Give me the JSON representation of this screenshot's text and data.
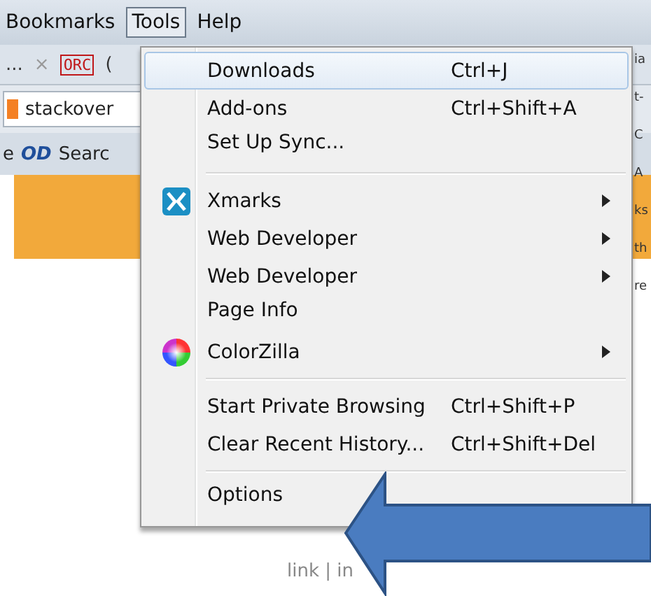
{
  "menubar": [
    {
      "label": "Bookmarks",
      "selected": false
    },
    {
      "label": "Tools",
      "selected": true
    },
    {
      "label": "Help",
      "selected": false
    }
  ],
  "tab_strip": {
    "tab_text": "...",
    "close": "×",
    "favicon": "ORC",
    "tab_text_2": "("
  },
  "address_bar": {
    "value": "stackover"
  },
  "bookmarks_bar": {
    "lead": "e",
    "logo": "OD",
    "label": "Searc"
  },
  "page_fragments": [
    "ia",
    "t-",
    "C",
    "A",
    "ks",
    "th",
    "re"
  ],
  "footer_fragment": "link | in",
  "tools_menu": [
    {
      "kind": "item",
      "label": "Downloads",
      "shortcut": "Ctrl+J",
      "highlighted": true
    },
    {
      "kind": "item",
      "label": "Add-ons",
      "shortcut": "Ctrl+Shift+A",
      "highlighted": false
    },
    {
      "kind": "item",
      "label": "Set Up Sync...",
      "highlighted": false
    },
    {
      "kind": "separator"
    },
    {
      "kind": "submenu",
      "label": "Xmarks",
      "highlighted": false
    },
    {
      "kind": "submenu",
      "label": "Web Developer",
      "highlighted": false
    },
    {
      "kind": "submenu",
      "label": "Web Developer",
      "highlighted": false
    },
    {
      "kind": "item",
      "label": "Page Info",
      "highlighted": false
    },
    {
      "kind": "submenu",
      "label": "ColorZilla",
      "highlighted": false
    },
    {
      "kind": "separator"
    },
    {
      "kind": "item",
      "label": "Start Private Browsing",
      "shortcut": "Ctrl+Shift+P",
      "highlighted": false
    },
    {
      "kind": "item",
      "label": "Clear Recent History...",
      "shortcut": "Ctrl+Shift+Del",
      "highlighted": false
    },
    {
      "kind": "separator"
    },
    {
      "kind": "item",
      "label": "Options",
      "highlighted": false
    }
  ]
}
